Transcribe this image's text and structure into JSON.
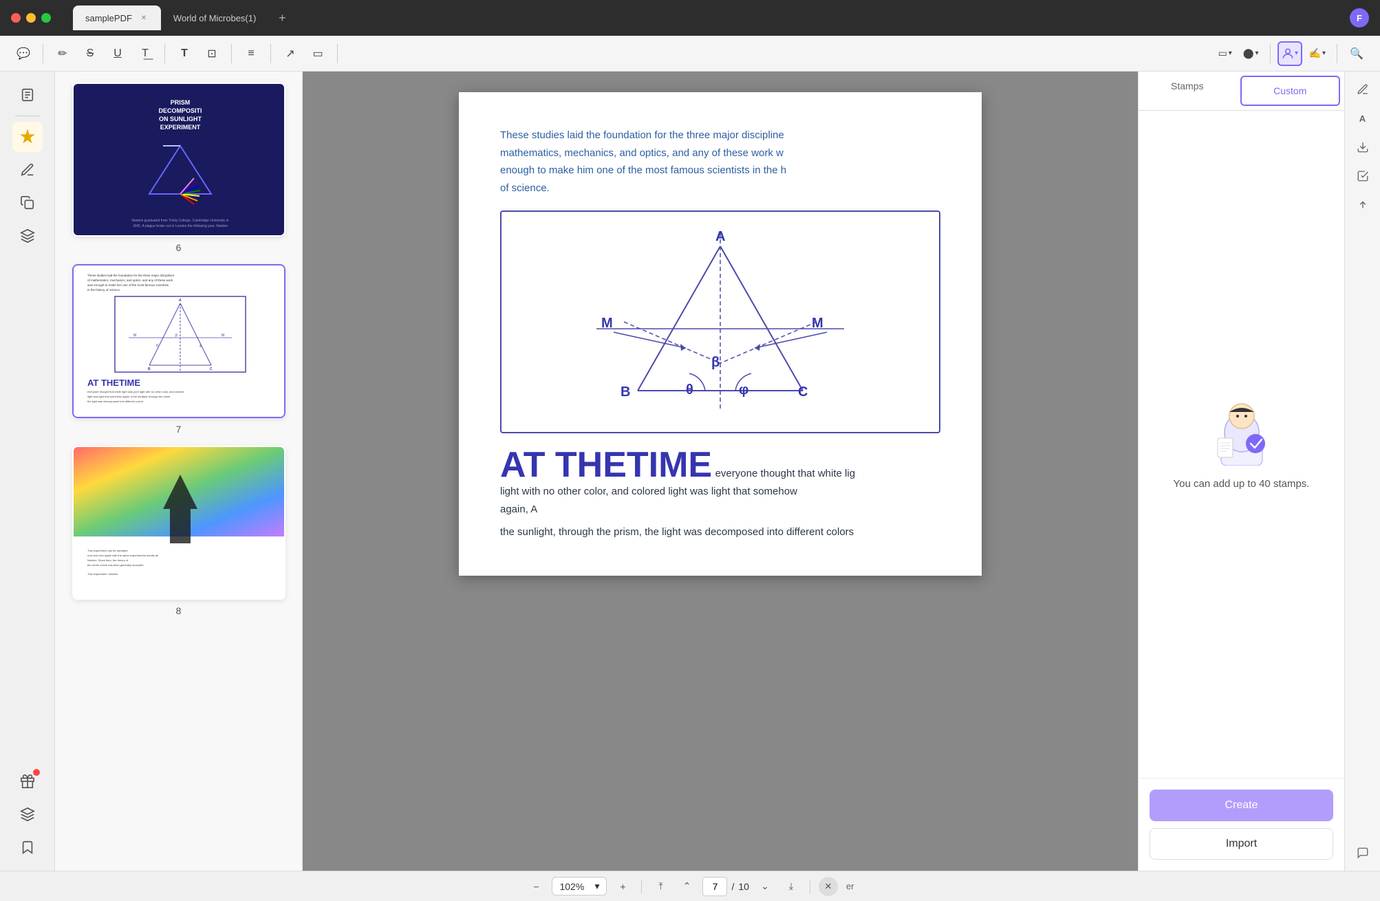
{
  "titlebar": {
    "tabs": [
      {
        "label": "samplePDF",
        "active": true
      },
      {
        "label": "World of Microbes(1)",
        "active": false
      }
    ],
    "add_tab_label": "+",
    "avatar_label": "F"
  },
  "toolbar": {
    "buttons": [
      {
        "name": "comment-btn",
        "icon": "💬"
      },
      {
        "name": "highlight-btn",
        "icon": "✏"
      },
      {
        "name": "strikethrough-btn",
        "icon": "S̶"
      },
      {
        "name": "underline-btn",
        "icon": "U̲"
      },
      {
        "name": "text-color-btn",
        "icon": "T"
      },
      {
        "name": "text-font-btn",
        "icon": "T"
      },
      {
        "name": "text-box-btn",
        "icon": "⬜"
      },
      {
        "name": "note-btn",
        "icon": "📋"
      },
      {
        "name": "arrow-btn",
        "icon": "↗"
      },
      {
        "name": "shape-btn",
        "icon": "▭"
      },
      {
        "name": "color-btn",
        "icon": "🎨"
      },
      {
        "name": "stamp-btn",
        "icon": "👤"
      },
      {
        "name": "signature-btn",
        "icon": "✍"
      },
      {
        "name": "search-btn",
        "icon": "🔍"
      }
    ]
  },
  "sidebar": {
    "items": [
      {
        "name": "pages-icon",
        "icon": "📄",
        "active": false
      },
      {
        "name": "highlight-sidebar-icon",
        "icon": "🖊",
        "active": true
      },
      {
        "name": "annotate-icon",
        "icon": "✏",
        "active": false
      },
      {
        "name": "layers-icon",
        "icon": "📑",
        "active": false
      },
      {
        "name": "bookmark-icon",
        "icon": "🔖",
        "active": false
      },
      {
        "name": "stamp-sidebar-icon",
        "icon": "🎁",
        "active": false,
        "has_badge": true
      },
      {
        "name": "stack-icon",
        "icon": "≡",
        "active": false
      },
      {
        "name": "comments-icon",
        "icon": "💬",
        "active": false
      }
    ]
  },
  "thumbnails": [
    {
      "page_num": "6",
      "selected": false,
      "title": "PRISM DECOMPOSITI ON SUNLIGHT EXPERIMENT"
    },
    {
      "page_num": "7",
      "selected": true,
      "content_preview": "These studies laid the foundation..."
    },
    {
      "page_num": "8",
      "selected": false
    }
  ],
  "pdf": {
    "intro_text": "These studies laid the foundation for the three major disciplines of mathematics, mechanics, and optics, and any of these work was enough to make him one of the most famous scientists in the history of science.",
    "big_title": "AT THETIME",
    "body_text": "everyone thought that white light was pure light with no other color, and colored light was light that somehow again, A the sunlight, through the prism, the light was decomposed into different colors"
  },
  "stamps_panel": {
    "tabs": [
      {
        "label": "Stamps",
        "active": false
      },
      {
        "label": "Custom",
        "active": true
      }
    ],
    "info_text": "You can add up to 40 stamps.",
    "create_label": "Create",
    "import_label": "Import"
  },
  "bottom_bar": {
    "zoom_value": "102%",
    "page_current": "7",
    "page_total": "10"
  },
  "far_right": {
    "icons": [
      {
        "name": "right-icon-1",
        "icon": "🖊"
      },
      {
        "name": "right-icon-2",
        "icon": "A"
      },
      {
        "name": "right-icon-3",
        "icon": "⬇"
      },
      {
        "name": "right-icon-4",
        "icon": "☑"
      },
      {
        "name": "right-icon-5",
        "icon": "↑"
      },
      {
        "name": "right-icon-6",
        "icon": "💬"
      }
    ]
  }
}
